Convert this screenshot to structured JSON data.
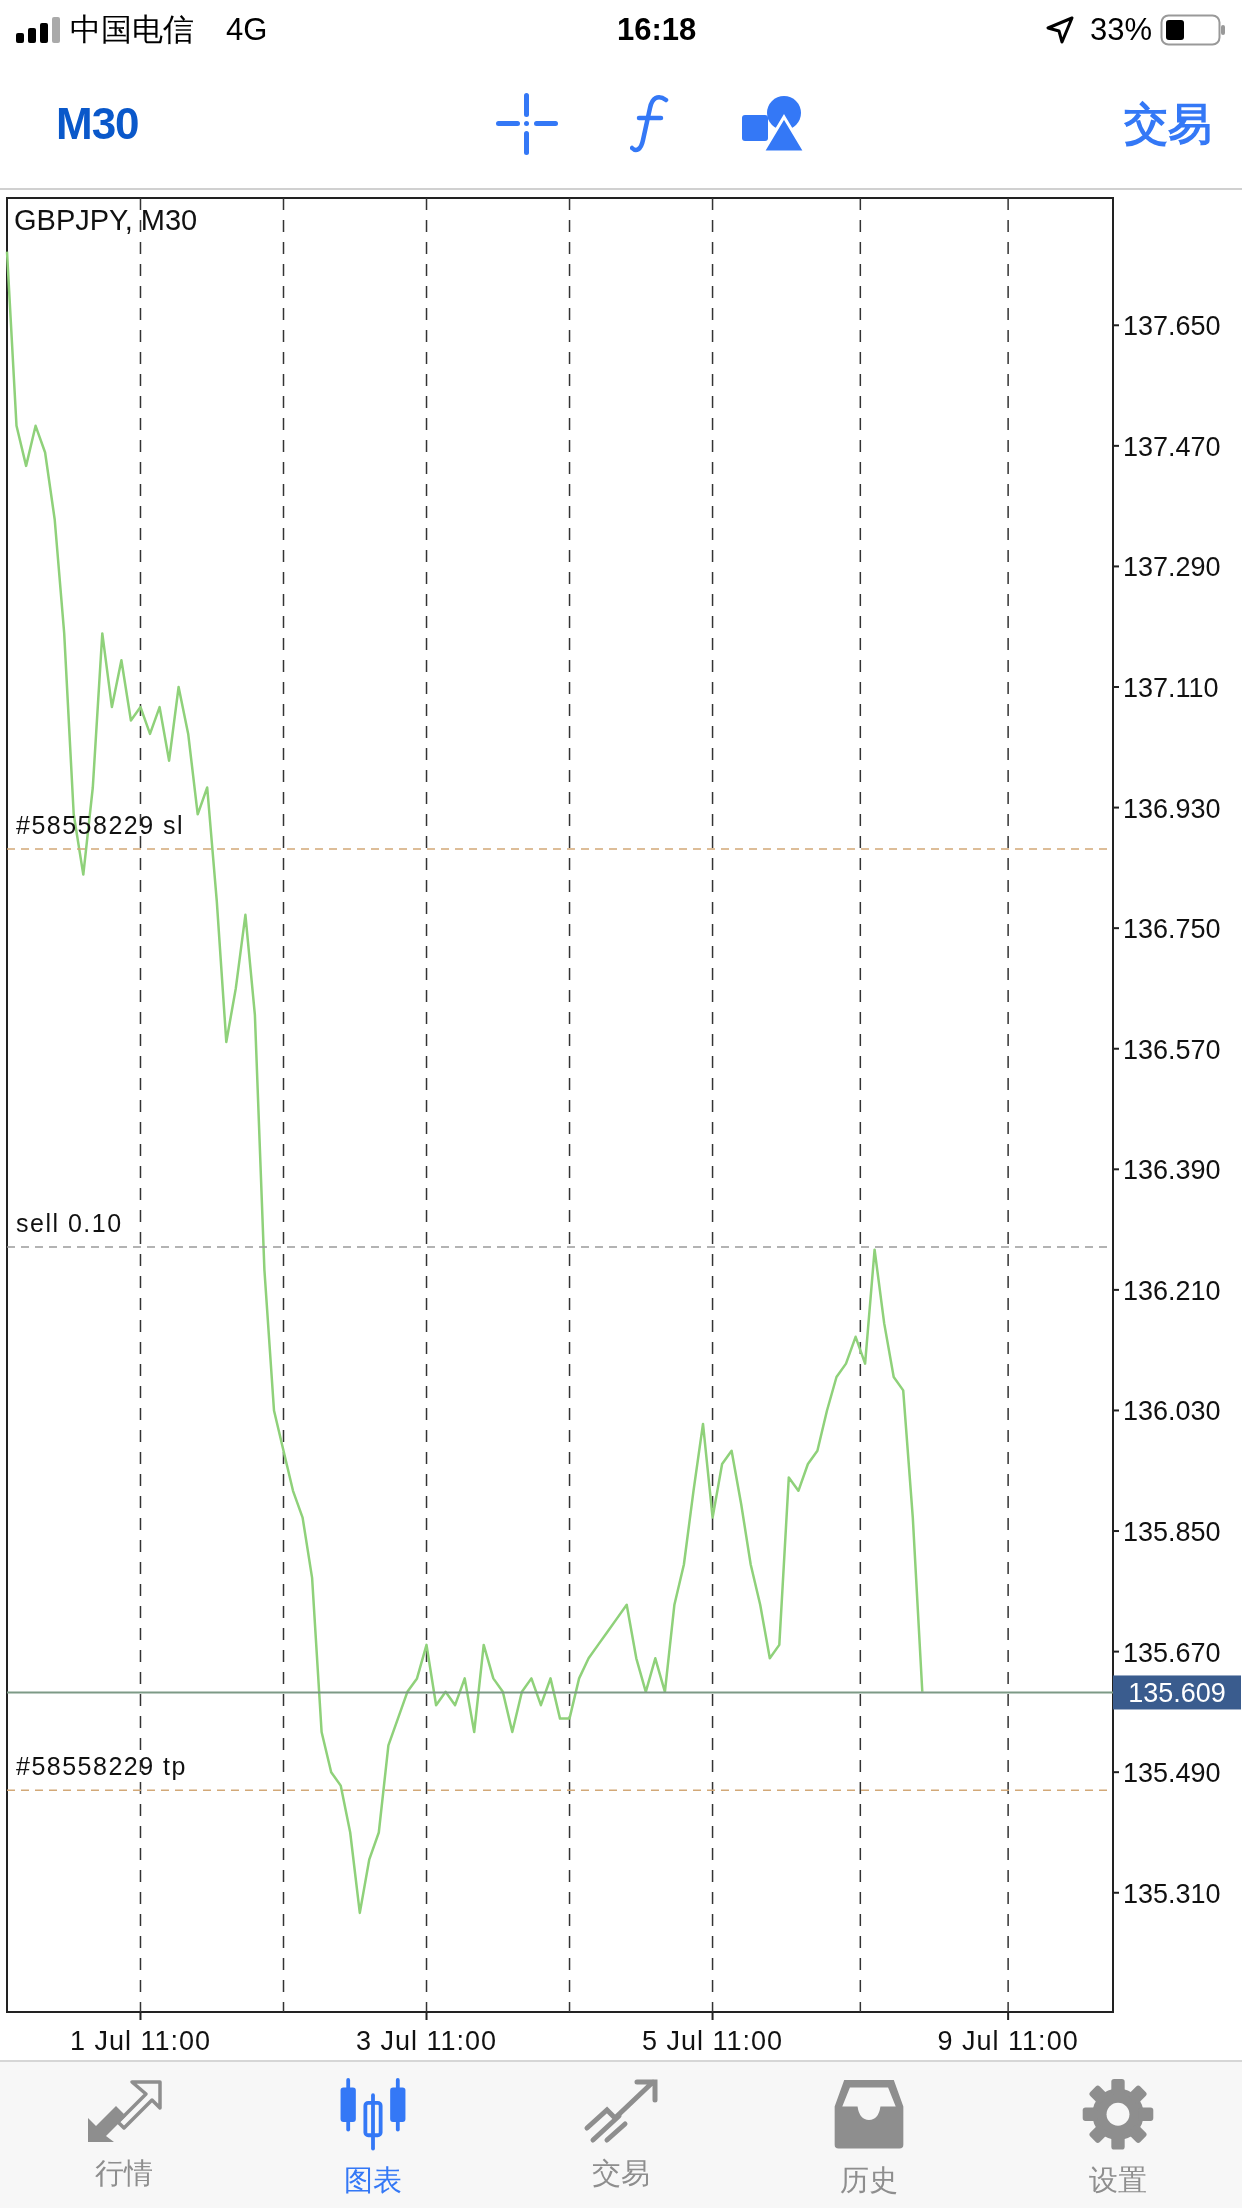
{
  "status_bar": {
    "carrier": "中国电信",
    "network": "4G",
    "time": "16:18",
    "battery": "33%"
  },
  "toolbar": {
    "timeframe": "M30",
    "action": "交易"
  },
  "chart": {
    "title": "GBPJPY, M30",
    "chart_data": {
      "type": "line",
      "grid": true,
      "ylim": [
        135.132,
        137.84
      ],
      "categories": [
        null,
        null,
        null,
        null,
        null,
        null,
        null,
        null,
        null,
        null,
        null,
        null,
        null,
        null,
        "1 Jul 11:00",
        null,
        null,
        null,
        null,
        null,
        null,
        null,
        null,
        null,
        null,
        null,
        null,
        null,
        null,
        null,
        null,
        null,
        null,
        null,
        null,
        null,
        null,
        null,
        null,
        null,
        null,
        null,
        null,
        null,
        "3 Jul 11:00",
        null,
        null,
        null,
        null,
        null,
        null,
        null,
        null,
        null,
        null,
        null,
        null,
        null,
        null,
        null,
        null,
        null,
        null,
        null,
        null,
        null,
        null,
        null,
        null,
        null,
        null,
        null,
        null,
        null,
        "5 Jul 11:00",
        null,
        null,
        null,
        null,
        null,
        null,
        null,
        null,
        null,
        null,
        null,
        null,
        null,
        null,
        null,
        null,
        null,
        null,
        null,
        null,
        null,
        null,
        null,
        null,
        null,
        null,
        null,
        null,
        null,
        null,
        "9 Jul 11:00",
        null,
        null,
        null,
        null,
        null,
        null,
        null,
        null,
        null,
        null,
        null
      ],
      "yticks": [
        {
          "value": 137.65,
          "label": "137.650"
        },
        {
          "value": 137.47,
          "label": "137.470"
        },
        {
          "value": 137.29,
          "label": "137.290"
        },
        {
          "value": 137.11,
          "label": "137.110"
        },
        {
          "value": 136.93,
          "label": "136.930"
        },
        {
          "value": 136.75,
          "label": "136.750"
        },
        {
          "value": 136.57,
          "label": "136.570"
        },
        {
          "value": 136.39,
          "label": "136.390"
        },
        {
          "value": 136.21,
          "label": "136.210"
        },
        {
          "value": 136.03,
          "label": "136.030"
        },
        {
          "value": 135.85,
          "label": "135.850"
        },
        {
          "value": 135.67,
          "label": "135.670"
        },
        {
          "value": 135.49,
          "label": "135.490"
        },
        {
          "value": 135.31,
          "label": "135.310"
        }
      ],
      "series": [
        {
          "color": "#8fd17a",
          "values": [
            137.76,
            137.5,
            137.44,
            137.5,
            137.46,
            137.36,
            137.19,
            136.92,
            136.83,
            136.96,
            137.19,
            137.08,
            137.15,
            137.06,
            137.08,
            137.04,
            137.08,
            137.0,
            137.11,
            137.04,
            136.92,
            136.96,
            136.79,
            136.58,
            136.66,
            136.77,
            136.62,
            136.24,
            136.03,
            135.97,
            135.91,
            135.87,
            135.78,
            135.55,
            135.49,
            135.47,
            135.4,
            135.28,
            135.36,
            135.4,
            135.53,
            135.57,
            135.61,
            135.63,
            135.68,
            135.59,
            135.61,
            135.59,
            135.63,
            135.55,
            135.68,
            135.63,
            135.61,
            135.55,
            135.61,
            135.63,
            135.59,
            135.63,
            135.57,
            135.57,
            135.63,
            135.66,
            135.68,
            135.7,
            135.72,
            135.74,
            135.66,
            135.61,
            135.66,
            135.61,
            135.74,
            135.8,
            135.91,
            136.01,
            135.87,
            135.95,
            135.97,
            135.89,
            135.8,
            135.74,
            135.66,
            135.68,
            135.93,
            135.91,
            135.95,
            135.97,
            136.03,
            136.08,
            136.1,
            136.14,
            136.1,
            136.27,
            136.16,
            136.08,
            136.06,
            135.87,
            135.61,
            null,
            null,
            null,
            null,
            null,
            null,
            null,
            null,
            null,
            null,
            null,
            null,
            null,
            null,
            null,
            null,
            null,
            null,
            null,
            null
          ]
        }
      ],
      "ref_lines": [
        {
          "axis": "y",
          "label": "#58558229 sl",
          "value": 136.868,
          "color": "#d2a877"
        },
        {
          "axis": "y",
          "label": "sell 0.10",
          "value": 136.274,
          "color": "#9a9a9a"
        },
        {
          "axis": "y",
          "label": "#58558229 tp",
          "value": 135.463,
          "color": "#d2a877"
        },
        {
          "axis": "y",
          "label": "135.609",
          "value": 135.609,
          "color": "#7d9a86"
        }
      ]
    }
  },
  "tab_bar": [
    {
      "label": "行情",
      "selected": false
    },
    {
      "label": "图表",
      "selected": true
    },
    {
      "label": "交易",
      "selected": false
    },
    {
      "label": "历史",
      "selected": false
    },
    {
      "label": "设置",
      "selected": false
    }
  ]
}
